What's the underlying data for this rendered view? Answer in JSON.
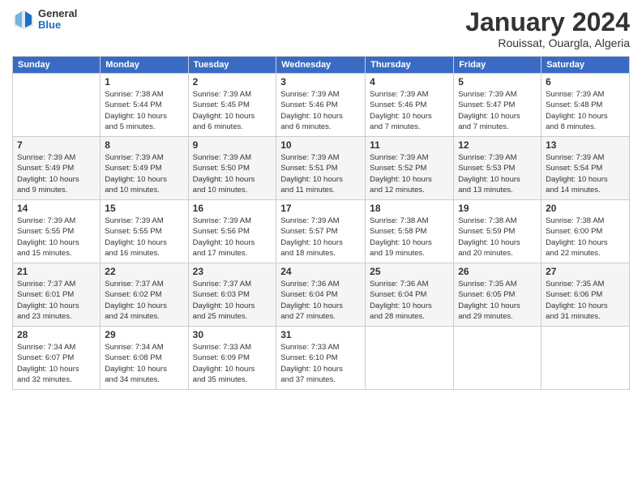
{
  "logo": {
    "general": "General",
    "blue": "Blue"
  },
  "header": {
    "title": "January 2024",
    "subtitle": "Rouissat, Ouargla, Algeria"
  },
  "days_of_week": [
    "Sunday",
    "Monday",
    "Tuesday",
    "Wednesday",
    "Thursday",
    "Friday",
    "Saturday"
  ],
  "weeks": [
    [
      {
        "day": "",
        "info": ""
      },
      {
        "day": "1",
        "info": "Sunrise: 7:38 AM\nSunset: 5:44 PM\nDaylight: 10 hours\nand 5 minutes."
      },
      {
        "day": "2",
        "info": "Sunrise: 7:39 AM\nSunset: 5:45 PM\nDaylight: 10 hours\nand 6 minutes."
      },
      {
        "day": "3",
        "info": "Sunrise: 7:39 AM\nSunset: 5:46 PM\nDaylight: 10 hours\nand 6 minutes."
      },
      {
        "day": "4",
        "info": "Sunrise: 7:39 AM\nSunset: 5:46 PM\nDaylight: 10 hours\nand 7 minutes."
      },
      {
        "day": "5",
        "info": "Sunrise: 7:39 AM\nSunset: 5:47 PM\nDaylight: 10 hours\nand 7 minutes."
      },
      {
        "day": "6",
        "info": "Sunrise: 7:39 AM\nSunset: 5:48 PM\nDaylight: 10 hours\nand 8 minutes."
      }
    ],
    [
      {
        "day": "7",
        "info": "Sunrise: 7:39 AM\nSunset: 5:49 PM\nDaylight: 10 hours\nand 9 minutes."
      },
      {
        "day": "8",
        "info": "Sunrise: 7:39 AM\nSunset: 5:49 PM\nDaylight: 10 hours\nand 10 minutes."
      },
      {
        "day": "9",
        "info": "Sunrise: 7:39 AM\nSunset: 5:50 PM\nDaylight: 10 hours\nand 10 minutes."
      },
      {
        "day": "10",
        "info": "Sunrise: 7:39 AM\nSunset: 5:51 PM\nDaylight: 10 hours\nand 11 minutes."
      },
      {
        "day": "11",
        "info": "Sunrise: 7:39 AM\nSunset: 5:52 PM\nDaylight: 10 hours\nand 12 minutes."
      },
      {
        "day": "12",
        "info": "Sunrise: 7:39 AM\nSunset: 5:53 PM\nDaylight: 10 hours\nand 13 minutes."
      },
      {
        "day": "13",
        "info": "Sunrise: 7:39 AM\nSunset: 5:54 PM\nDaylight: 10 hours\nand 14 minutes."
      }
    ],
    [
      {
        "day": "14",
        "info": "Sunrise: 7:39 AM\nSunset: 5:55 PM\nDaylight: 10 hours\nand 15 minutes."
      },
      {
        "day": "15",
        "info": "Sunrise: 7:39 AM\nSunset: 5:55 PM\nDaylight: 10 hours\nand 16 minutes."
      },
      {
        "day": "16",
        "info": "Sunrise: 7:39 AM\nSunset: 5:56 PM\nDaylight: 10 hours\nand 17 minutes."
      },
      {
        "day": "17",
        "info": "Sunrise: 7:39 AM\nSunset: 5:57 PM\nDaylight: 10 hours\nand 18 minutes."
      },
      {
        "day": "18",
        "info": "Sunrise: 7:38 AM\nSunset: 5:58 PM\nDaylight: 10 hours\nand 19 minutes."
      },
      {
        "day": "19",
        "info": "Sunrise: 7:38 AM\nSunset: 5:59 PM\nDaylight: 10 hours\nand 20 minutes."
      },
      {
        "day": "20",
        "info": "Sunrise: 7:38 AM\nSunset: 6:00 PM\nDaylight: 10 hours\nand 22 minutes."
      }
    ],
    [
      {
        "day": "21",
        "info": "Sunrise: 7:37 AM\nSunset: 6:01 PM\nDaylight: 10 hours\nand 23 minutes."
      },
      {
        "day": "22",
        "info": "Sunrise: 7:37 AM\nSunset: 6:02 PM\nDaylight: 10 hours\nand 24 minutes."
      },
      {
        "day": "23",
        "info": "Sunrise: 7:37 AM\nSunset: 6:03 PM\nDaylight: 10 hours\nand 25 minutes."
      },
      {
        "day": "24",
        "info": "Sunrise: 7:36 AM\nSunset: 6:04 PM\nDaylight: 10 hours\nand 27 minutes."
      },
      {
        "day": "25",
        "info": "Sunrise: 7:36 AM\nSunset: 6:04 PM\nDaylight: 10 hours\nand 28 minutes."
      },
      {
        "day": "26",
        "info": "Sunrise: 7:35 AM\nSunset: 6:05 PM\nDaylight: 10 hours\nand 29 minutes."
      },
      {
        "day": "27",
        "info": "Sunrise: 7:35 AM\nSunset: 6:06 PM\nDaylight: 10 hours\nand 31 minutes."
      }
    ],
    [
      {
        "day": "28",
        "info": "Sunrise: 7:34 AM\nSunset: 6:07 PM\nDaylight: 10 hours\nand 32 minutes."
      },
      {
        "day": "29",
        "info": "Sunrise: 7:34 AM\nSunset: 6:08 PM\nDaylight: 10 hours\nand 34 minutes."
      },
      {
        "day": "30",
        "info": "Sunrise: 7:33 AM\nSunset: 6:09 PM\nDaylight: 10 hours\nand 35 minutes."
      },
      {
        "day": "31",
        "info": "Sunrise: 7:33 AM\nSunset: 6:10 PM\nDaylight: 10 hours\nand 37 minutes."
      },
      {
        "day": "",
        "info": ""
      },
      {
        "day": "",
        "info": ""
      },
      {
        "day": "",
        "info": ""
      }
    ]
  ]
}
